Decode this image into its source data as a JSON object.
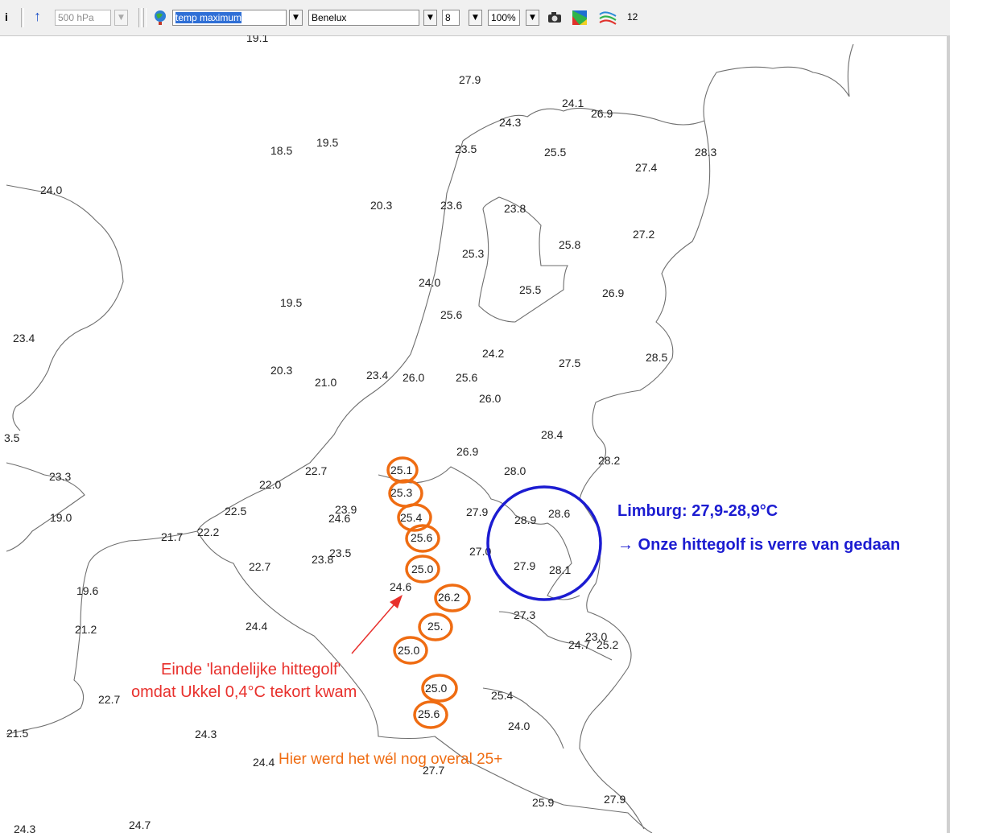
{
  "toolbar": {
    "level_value": "500 hPa",
    "parameter_value": "temp maximum",
    "region_value": "Benelux",
    "size_value": "8",
    "zoom_value": "100%",
    "number_value": "12",
    "icons": [
      "info-icon",
      "up-arrow-icon",
      "globe-icon",
      "camera-icon",
      "color-map-icon",
      "contour-lines-icon"
    ]
  },
  "stations": [
    "19.1",
    "27.9",
    "24.1",
    "26.9",
    "24.3",
    "18.5",
    "19.5",
    "23.5",
    "25.5",
    "28.3",
    "27.4",
    "24.0",
    "20.3",
    "23.6",
    "23.8",
    "27.2",
    "25.8",
    "25.3",
    "24.0",
    "25.5",
    "26.9",
    "19.5",
    "25.6",
    "23.4",
    "24.2",
    "27.5",
    "28.5",
    "20.3",
    "21.0",
    "23.4",
    "26.0",
    "25.6",
    "26.0",
    "28.4",
    "3.5",
    "26.9",
    "28.2",
    "23.3",
    "22.7",
    "25.1",
    "28.0",
    "22.0",
    "25.3",
    "22.5",
    "23.9",
    "24.6",
    "25.4",
    "27.9",
    "28.9",
    "28.6",
    "19.0",
    "21.7",
    "22.2",
    "25.6",
    "27.0",
    "23.5",
    "23.8",
    "22.7",
    "25.0",
    "27.9",
    "28.1",
    "19.6",
    "24.6",
    "26.2",
    "27.3",
    "21.2",
    "24.4",
    "25.",
    "23.0",
    "24.7",
    "25.2",
    "25.0",
    "25.0",
    "22.7",
    "25.4",
    "25.6",
    "24.0",
    "21.5",
    "24.3",
    "24.4",
    "27.7",
    "25.9",
    "27.9",
    "24.3",
    "24.7"
  ],
  "annotations": {
    "red_line1": "Einde 'landelijke hittegolf'",
    "red_line2": "omdat Ukkel 0,4°C tekort kwam",
    "orange": "Hier werd het wél nog overal 25+",
    "blue_line1": "Limburg: 27,9-28,9°C",
    "blue_line2": "→ Onze hittegolf is verre van gedaan"
  },
  "colors": {
    "red": "#e8302c",
    "orange": "#ef6c12",
    "blue": "#1c1cd1",
    "coast": "#6e6e6e"
  }
}
